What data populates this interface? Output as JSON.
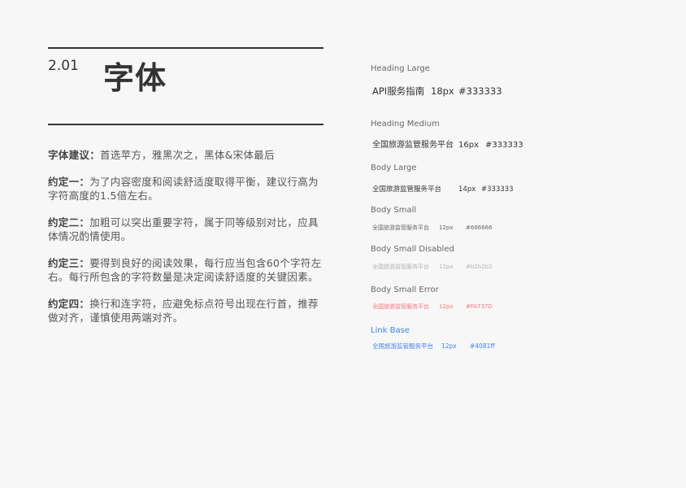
{
  "header": {
    "section_number": "2.01",
    "title": "字体"
  },
  "guidelines": [
    {
      "label": "字体建议：",
      "text": "首选苹方，雅黑次之，黑体&宋体最后"
    },
    {
      "label": "约定一：",
      "text": "为了内容密度和阅读舒适度取得平衡，建议行高为字符高度的1.5倍左右。"
    },
    {
      "label": "约定二：",
      "text": "加粗可以突出重要字符，属于同等级别对比，应具体情况酌情使用。"
    },
    {
      "label": "约定三：",
      "text": "要得到良好的阅读效果，每行应当包含60个字符左右。每行所包含的字符数量是决定阅读舒适度的关键因素。"
    },
    {
      "label": "约定四：",
      "text": "换行和连字符，应避免标点符号出现在行首，推荐做对齐，谨慎使用两端对齐。"
    }
  ],
  "type_specs": [
    {
      "name": "Heading Large",
      "sample": "API服务指南",
      "size": "18px",
      "color_label": "#333333",
      "color": "#333333",
      "name_color": "#666666"
    },
    {
      "name": "Heading Medium",
      "sample": "全国旅游监管服务平台",
      "size": "16px",
      "color_label": "#333333",
      "color": "#333333",
      "name_color": "#666666"
    },
    {
      "name": "Body Large",
      "sample": "全国旅游监管服务平台",
      "size": "14px",
      "color_label": "#333333",
      "color": "#333333",
      "name_color": "#666666"
    },
    {
      "name": "Body Small",
      "sample": "全国旅游监管服务平台",
      "size": "12px",
      "color_label": "#666666",
      "color": "#666666",
      "name_color": "#666666"
    },
    {
      "name": "Body Small Disabled",
      "sample": "全国旅游监管服务平台",
      "size": "12px",
      "color_label": "#b2b2b2",
      "color": "#b2b2b2",
      "name_color": "#666666"
    },
    {
      "name": "Body Small Error",
      "sample": "全国旅游监管服务平台",
      "size": "12px",
      "color_label": "#FA737D",
      "color": "#FA737D",
      "name_color": "#666666"
    },
    {
      "name": "Link Base",
      "sample": "全国旅游监管服务平台",
      "size": "12px",
      "color_label": "#4081ff",
      "color": "#4081ff",
      "name_color": "#4081ff"
    }
  ]
}
